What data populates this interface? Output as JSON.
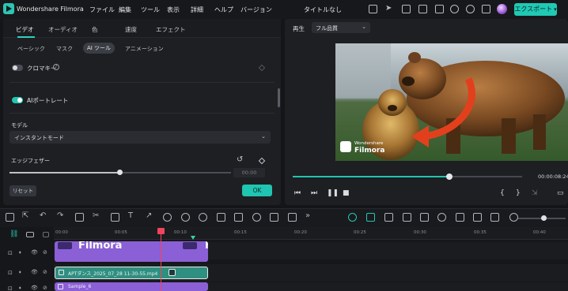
{
  "app": {
    "name": "Wondershare Filmora",
    "doc_title": "タイトルなし",
    "export_label": "エクスポート"
  },
  "menu": [
    "ファイル",
    "編集",
    "ツール",
    "表示",
    "詳細",
    "ヘルプ",
    "バージョン"
  ],
  "colors": {
    "accent": "#22c6b1",
    "playhead": "#f0445c",
    "clip_purple": "#8b5fd6"
  },
  "panel": {
    "tabs": [
      "ビデオ",
      "オーディオ",
      "色",
      "速度",
      "エフェクト"
    ],
    "active_tab": "ビデオ",
    "subtabs": [
      "ベーシック",
      "マスク",
      "AI ツール",
      "アニメーション"
    ],
    "active_subtab": "AI ツール",
    "chroma_key": {
      "label": "クロマキー",
      "help": "?",
      "enabled": false
    },
    "ai_portrait": {
      "label": "AIポートレート",
      "enabled": true
    },
    "model": {
      "label": "モデル",
      "value": "インスタントモード"
    },
    "edge_feather": {
      "label": "エッジフェザー",
      "value": "00:00",
      "level": 0.5
    },
    "reset_label": "リセット",
    "ok_label": "OK"
  },
  "preview": {
    "play_label": "再生",
    "quality": "フル品質",
    "watermark_brand": "Wondershare",
    "watermark_name": "Filmora",
    "time": "00:00:08:24",
    "progress": 0.68
  },
  "timeline": {
    "ruler": [
      "00:00",
      "00:05",
      "00:10",
      "00:15",
      "00:20",
      "00:25",
      "00:30",
      "00:35",
      "00:40"
    ],
    "clip_filmora_label": "Filmora",
    "clip_video_label": "APTダンス_2025_07_28 11-30-55.mp4",
    "clip_sample_label": "Sample_6"
  }
}
